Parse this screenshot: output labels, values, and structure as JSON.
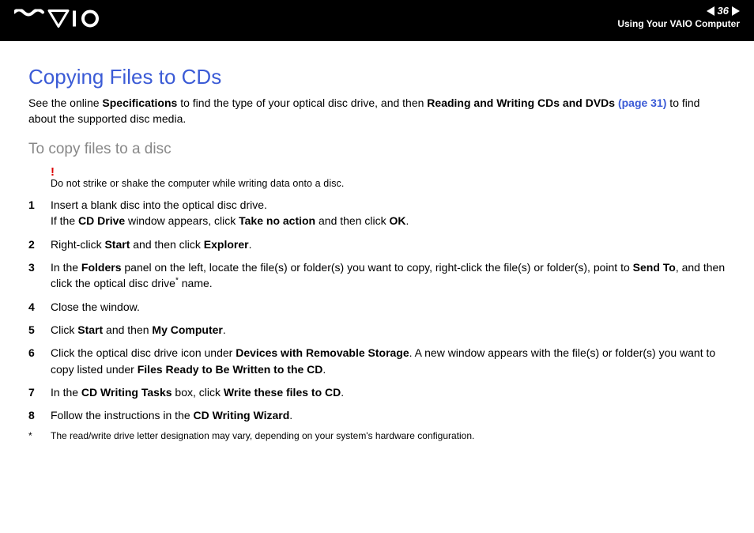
{
  "header": {
    "page_number": "36",
    "breadcrumb": "Using Your VAIO Computer"
  },
  "title": "Copying Files to CDs",
  "intro": {
    "t1": "See the online ",
    "b1": "Specifications",
    "t2": " to find the type of your optical disc drive, and then ",
    "b2": "Reading and Writing CDs and DVDs ",
    "link": "(page 31)",
    "t3": " to find about the supported disc media."
  },
  "subhead": "To copy files to a disc",
  "warning": {
    "mark": "!",
    "text": "Do not strike or shake the computer while writing data onto a disc."
  },
  "steps": [
    {
      "parts": [
        {
          "t": "Insert a blank disc into the optical disc drive."
        },
        {
          "br": true
        },
        {
          "t": "If the "
        },
        {
          "b": "CD Drive"
        },
        {
          "t": " window appears, click "
        },
        {
          "b": "Take no action"
        },
        {
          "t": " and then click "
        },
        {
          "b": "OK"
        },
        {
          "t": "."
        }
      ]
    },
    {
      "parts": [
        {
          "t": "Right-click "
        },
        {
          "b": "Start"
        },
        {
          "t": " and then click "
        },
        {
          "b": "Explorer"
        },
        {
          "t": "."
        }
      ]
    },
    {
      "parts": [
        {
          "t": "In the "
        },
        {
          "b": "Folders"
        },
        {
          "t": " panel on the left, locate the file(s) or folder(s) you want to copy, right-click the file(s) or folder(s), point to "
        },
        {
          "b": "Send To"
        },
        {
          "t": ", and then click the optical disc drive"
        },
        {
          "sup": "*"
        },
        {
          "t": " name."
        }
      ]
    },
    {
      "parts": [
        {
          "t": "Close the window."
        }
      ]
    },
    {
      "parts": [
        {
          "t": "Click "
        },
        {
          "b": "Start"
        },
        {
          "t": " and then "
        },
        {
          "b": "My Computer"
        },
        {
          "t": "."
        }
      ]
    },
    {
      "parts": [
        {
          "t": "Click the optical disc drive icon under "
        },
        {
          "b": "Devices with Removable Storage"
        },
        {
          "t": ". A new window appears with the file(s) or folder(s) you want to copy listed under "
        },
        {
          "b": "Files Ready to Be Written to the CD"
        },
        {
          "t": "."
        }
      ]
    },
    {
      "parts": [
        {
          "t": "In the "
        },
        {
          "b": "CD Writing Tasks"
        },
        {
          "t": " box, click "
        },
        {
          "b": "Write these files to CD"
        },
        {
          "t": "."
        }
      ]
    },
    {
      "parts": [
        {
          "t": "Follow the instructions in the "
        },
        {
          "b": "CD Writing Wizard"
        },
        {
          "t": "."
        }
      ]
    }
  ],
  "footnote": {
    "star": "*",
    "text": "The read/write drive letter designation may vary, depending on your system's hardware configuration."
  }
}
